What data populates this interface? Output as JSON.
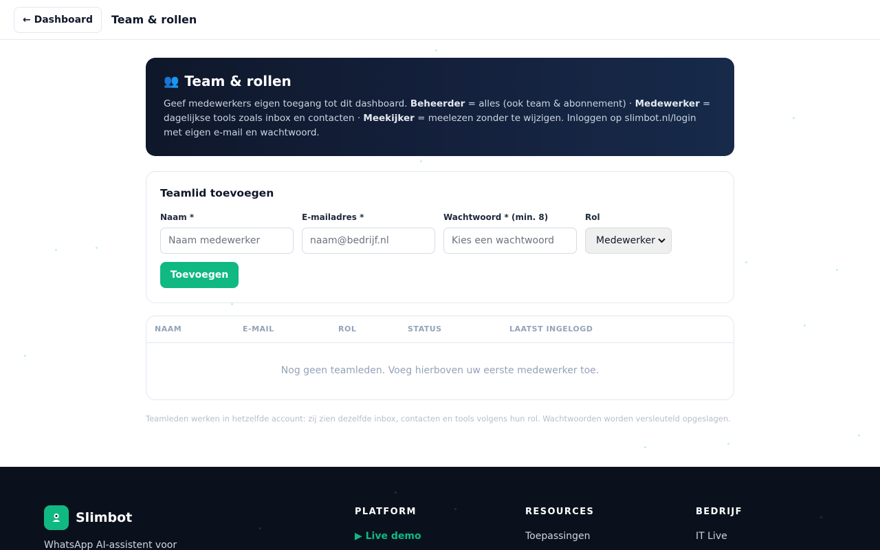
{
  "topbar": {
    "back_label": "← Dashboard",
    "title": "Team & rollen"
  },
  "hero": {
    "icon": "people-icon",
    "title": "Team & rollen",
    "desc_1": "Geef medewerkers eigen toegang tot dit dashboard. ",
    "role_admin": "Beheerder",
    "desc_2": " = alles (ook team & abonnement) · ",
    "role_employee": "Medewerker",
    "desc_3": " = dagelijkse tools zoals inbox en contacten · ",
    "role_viewer": "Meekijker",
    "desc_4": " = meelezen zonder te wijzigen. Inloggen op slimbot.nl/login met eigen e-mail en wachtwoord."
  },
  "form": {
    "title": "Teamlid toevoegen",
    "name_label": "Naam *",
    "name_placeholder": "Naam medewerker",
    "email_label": "E-mailadres *",
    "email_placeholder": "naam@bedrijf.nl",
    "password_label": "Wachtwoord * (min. 8)",
    "password_placeholder": "Kies een wachtwoord",
    "role_label": "Rol",
    "role_value": "Medewerker",
    "submit_label": "Toevoegen"
  },
  "table": {
    "headers": [
      "NAAM",
      "E-MAIL",
      "ROL",
      "STATUS",
      "LAATST INGELOGD"
    ],
    "empty_message": "Nog geen teamleden. Voeg hierboven uw eerste medewerker toe."
  },
  "footnote": "Teamleden werken in hetzelfde account: zij zien dezelfde inbox, contacten en tools volgens hun rol. Wachtwoorden worden versleuteld opgeslagen.",
  "footer": {
    "brand_name": "Slimbot",
    "tagline": "WhatsApp AI-assistent voor",
    "platform": {
      "heading": "PLATFORM",
      "link": "▶ Live demo"
    },
    "resources": {
      "heading": "RESOURCES",
      "link": "Toepassingen"
    },
    "company": {
      "heading": "BEDRIJF",
      "link": "IT Live"
    }
  },
  "colors": {
    "accent": "#10b981",
    "hero_bg": "#0f172a",
    "footer_bg": "#0b111c"
  }
}
